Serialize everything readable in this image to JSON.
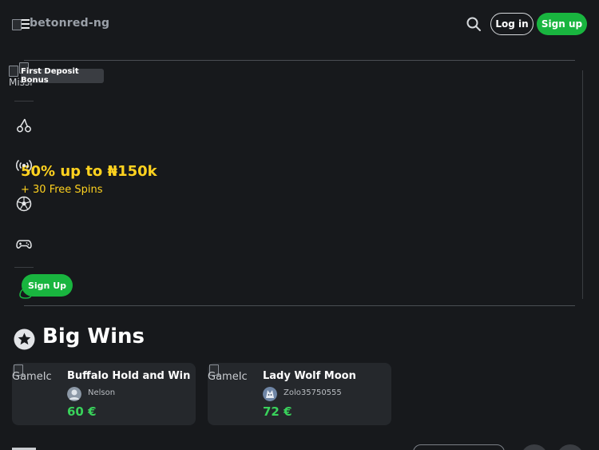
{
  "header": {
    "logo_alt": "betonred-ng",
    "login_label": "Log in",
    "signup_label": "Sign up"
  },
  "promo": {
    "badge": "First Deposit Bonus",
    "image_alt": "Missi",
    "title": "50% up to ₦150k",
    "subtitle": "+ 30 Free Spins",
    "button_label": "Sign Up"
  },
  "side_nav": {
    "icons": [
      "cherries-icon",
      "live-broadcast-icon",
      "football-icon",
      "gamepad-icon",
      "money-bag-icon"
    ]
  },
  "big_wins": {
    "title": "Big Wins",
    "items": [
      {
        "image_alt": "GameIc",
        "game": "Buffalo Hold and Win",
        "user": "Nelson",
        "amount": "60 €"
      },
      {
        "image_alt": "GameIc",
        "game": "Lady Wolf Moon",
        "user": "Zolo35750555",
        "amount": "72 €"
      }
    ]
  },
  "colors": {
    "background": "#17191c",
    "accent_green": "#19b53f",
    "promo_yellow": "#ffd21f",
    "win_green": "#39d25b",
    "card_bg": "#25282c"
  }
}
